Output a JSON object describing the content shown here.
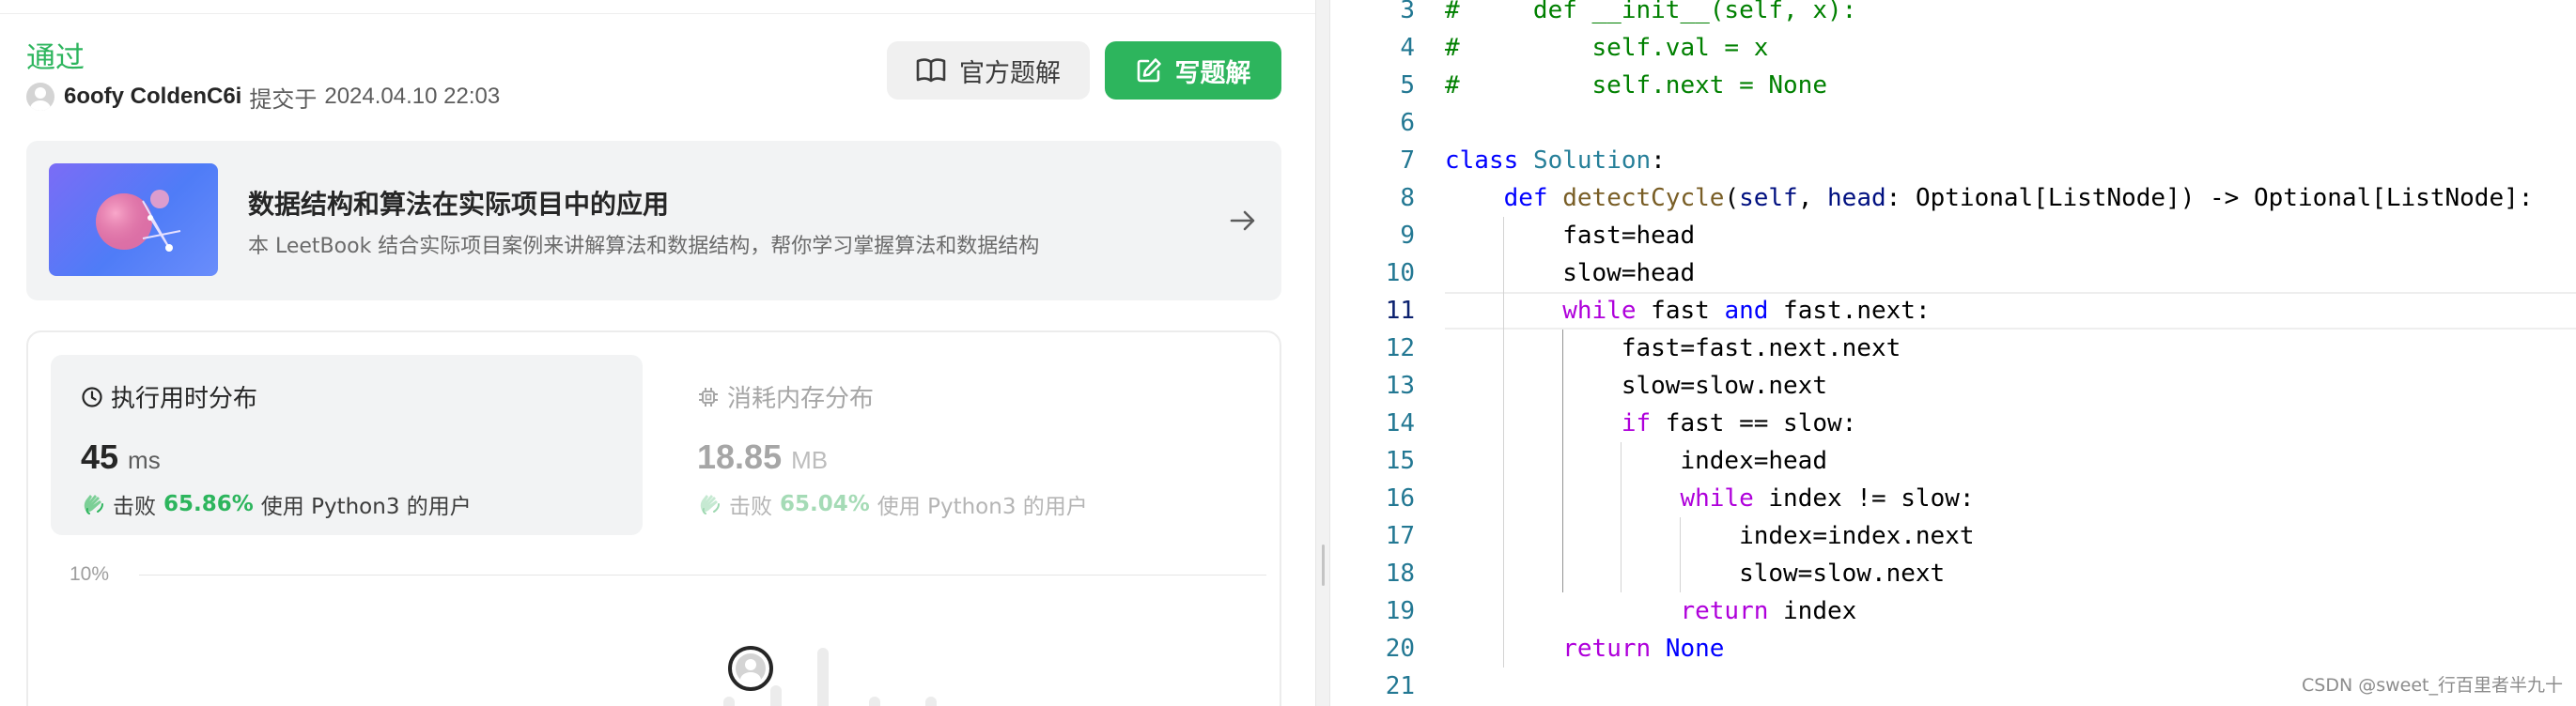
{
  "submission": {
    "status": "通过",
    "username": "6oofy ColdenC6i",
    "submitted_label": "提交于",
    "submitted_time": "2024.04.10 22:03"
  },
  "actions": {
    "official_solution": "官方题解",
    "write_solution": "写题解"
  },
  "leetbook": {
    "title": "数据结构和算法在实际项目中的应用",
    "description": "本 LeetBook 结合实际项目案例来讲解算法和数据结构，帮你学习掌握算法和数据结构"
  },
  "runtime": {
    "label": "执行用时分布",
    "value": "45",
    "unit": "ms",
    "beat_prefix": "击败",
    "percent": "65.86%",
    "beat_suffix": "使用 Python3 的用户"
  },
  "memory": {
    "label": "消耗内存分布",
    "value": "18.85",
    "unit": "MB",
    "beat_prefix": "击败",
    "percent": "65.04%",
    "beat_suffix": "使用 Python3 的用户"
  },
  "chart": {
    "y_tick": "10%"
  },
  "editor": {
    "current_line": "11",
    "lines": [
      {
        "n": "3",
        "tokens": [
          {
            "t": "#     def __init__(self, x):",
            "c": "cm"
          }
        ]
      },
      {
        "n": "4",
        "tokens": [
          {
            "t": "#         self.val = x",
            "c": "cm"
          }
        ]
      },
      {
        "n": "5",
        "tokens": [
          {
            "t": "#         self.next = None",
            "c": "cm"
          }
        ]
      },
      {
        "n": "6",
        "tokens": []
      },
      {
        "n": "7",
        "tokens": [
          {
            "t": "class",
            "c": "k"
          },
          {
            "t": " "
          },
          {
            "t": "Solution",
            "c": "t"
          },
          {
            "t": ":"
          }
        ]
      },
      {
        "n": "8",
        "tokens": [
          {
            "t": "    "
          },
          {
            "t": "def",
            "c": "k"
          },
          {
            "t": " "
          },
          {
            "t": "detectCycle",
            "c": "f"
          },
          {
            "t": "("
          },
          {
            "t": "self",
            "c": "p"
          },
          {
            "t": ", "
          },
          {
            "t": "head",
            "c": "p"
          },
          {
            "t": ": Optional[ListNode]) -> Optional[ListNode]:"
          }
        ]
      },
      {
        "n": "9",
        "tokens": [
          {
            "t": "        fast=head"
          }
        ]
      },
      {
        "n": "10",
        "tokens": [
          {
            "t": "        slow=head"
          }
        ]
      },
      {
        "n": "11",
        "tokens": [
          {
            "t": "        "
          },
          {
            "t": "while",
            "c": "c"
          },
          {
            "t": " fast "
          },
          {
            "t": "and",
            "c": "k"
          },
          {
            "t": " fast.next:"
          }
        ]
      },
      {
        "n": "12",
        "tokens": [
          {
            "t": "            fast=fast.next.next"
          }
        ]
      },
      {
        "n": "13",
        "tokens": [
          {
            "t": "            slow=slow.next"
          }
        ]
      },
      {
        "n": "14",
        "tokens": [
          {
            "t": "            "
          },
          {
            "t": "if",
            "c": "c"
          },
          {
            "t": " fast == slow:"
          }
        ]
      },
      {
        "n": "15",
        "tokens": [
          {
            "t": "                index=head"
          }
        ]
      },
      {
        "n": "16",
        "tokens": [
          {
            "t": "                "
          },
          {
            "t": "while",
            "c": "c"
          },
          {
            "t": " index != slow:"
          }
        ]
      },
      {
        "n": "17",
        "tokens": [
          {
            "t": "                    index=index.next"
          }
        ]
      },
      {
        "n": "18",
        "tokens": [
          {
            "t": "                    slow=slow.next"
          }
        ]
      },
      {
        "n": "19",
        "tokens": [
          {
            "t": "                "
          },
          {
            "t": "return",
            "c": "c"
          },
          {
            "t": " index"
          }
        ]
      },
      {
        "n": "20",
        "tokens": [
          {
            "t": "        "
          },
          {
            "t": "return",
            "c": "c"
          },
          {
            "t": " "
          },
          {
            "t": "None",
            "c": "k"
          }
        ]
      },
      {
        "n": "21",
        "tokens": []
      }
    ]
  },
  "watermark": "CSDN @sweet_行百里者半九十",
  "colors": {
    "accent_green": "#2db55d",
    "keyword_blue": "#0000ff",
    "control_purple": "#af00db",
    "comment_green": "#008000",
    "function_brown": "#795e26",
    "type_teal": "#267f99",
    "line_number": "#237893"
  }
}
